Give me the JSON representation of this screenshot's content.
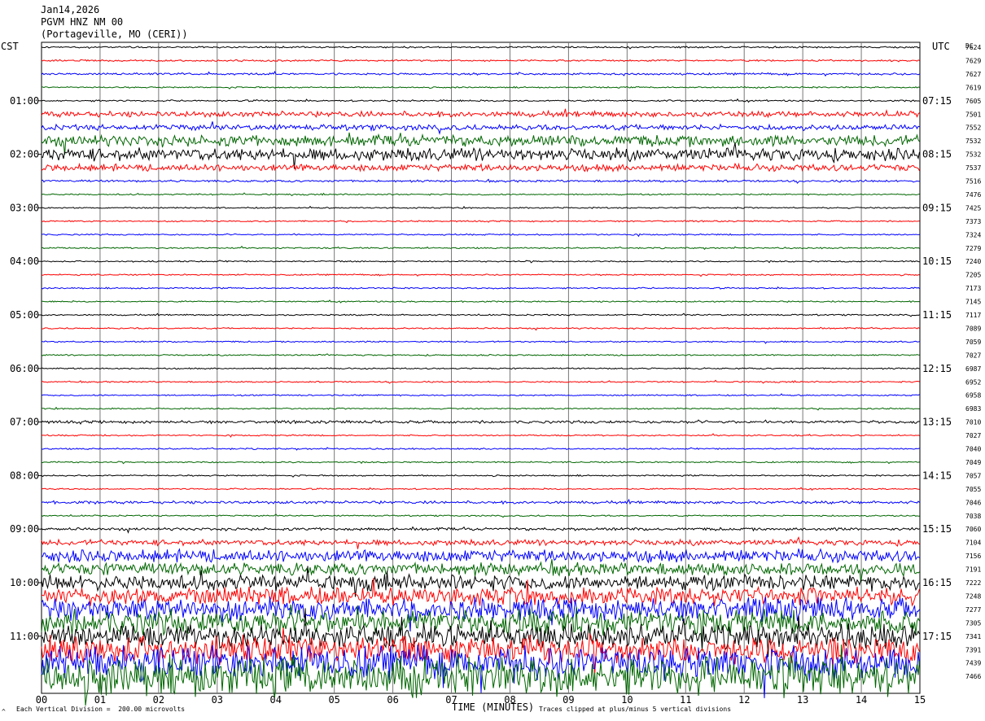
{
  "header": {
    "date": "Jan14,2026",
    "station": "PGVM HNZ NM 00",
    "location": "(Portageville, MO (CERI))"
  },
  "left_zone_label": "CST",
  "right_zone_label": "UTC",
  "dc_header": "DC",
  "footer": {
    "scale_note": "Each Vertical Division =  200.00 microvolts",
    "clip_note": "Traces clipped at plus/minus 5 vertical divisions",
    "mark": "^"
  },
  "chart_data": {
    "type": "line",
    "title": "",
    "xlabel": "TIME (MINUTES)",
    "ylabel": "",
    "xlim": [
      0,
      15
    ],
    "x_ticks": [
      "00",
      "01",
      "02",
      "03",
      "04",
      "05",
      "06",
      "07",
      "08",
      "09",
      "10",
      "11",
      "12",
      "13",
      "14",
      "15"
    ],
    "trace_colors": [
      "#000000",
      "#ff0000",
      "#0000ff",
      "#006600"
    ],
    "left_time_labels": [
      "01:00",
      "02:00",
      "03:00",
      "04:00",
      "05:00",
      "06:00",
      "07:00",
      "08:00",
      "09:00",
      "10:00",
      "11:00"
    ],
    "right_time_labels": [
      "07:15",
      "08:15",
      "09:15",
      "10:15",
      "11:15",
      "12:15",
      "13:15",
      "14:15",
      "15:15",
      "16:15",
      "17:15"
    ],
    "dc_values": [
      "7624",
      "7629",
      "7627",
      "7619",
      "7605",
      "7501",
      "7552",
      "7532",
      "7532",
      "7537",
      "7516",
      "7476",
      "7425",
      "7373",
      "7324",
      "7279",
      "7240",
      "7205",
      "7173",
      "7145",
      "7117",
      "7089",
      "7059",
      "7027",
      "6987",
      "6952",
      "6958",
      "6983",
      "7010",
      "7027",
      "7040",
      "7049",
      "7057",
      "7055",
      "7046",
      "7038",
      "7060",
      "7104",
      "7156",
      "7191",
      "7222",
      "7248",
      "7277",
      "7305",
      "7341",
      "7391",
      "7439",
      "7466"
    ],
    "trace_amplitude": [
      1.2,
      1.2,
      1.5,
      1,
      1.2,
      4,
      4,
      8,
      9,
      5,
      1.5,
      1,
      1,
      1,
      1,
      1,
      1,
      1,
      1,
      1,
      1,
      1,
      1,
      1,
      1,
      1,
      1,
      1,
      2,
      1,
      1,
      1,
      1,
      1,
      2,
      1,
      2,
      4,
      9,
      9,
      11,
      13,
      16,
      18,
      17,
      20,
      24,
      28
    ]
  }
}
